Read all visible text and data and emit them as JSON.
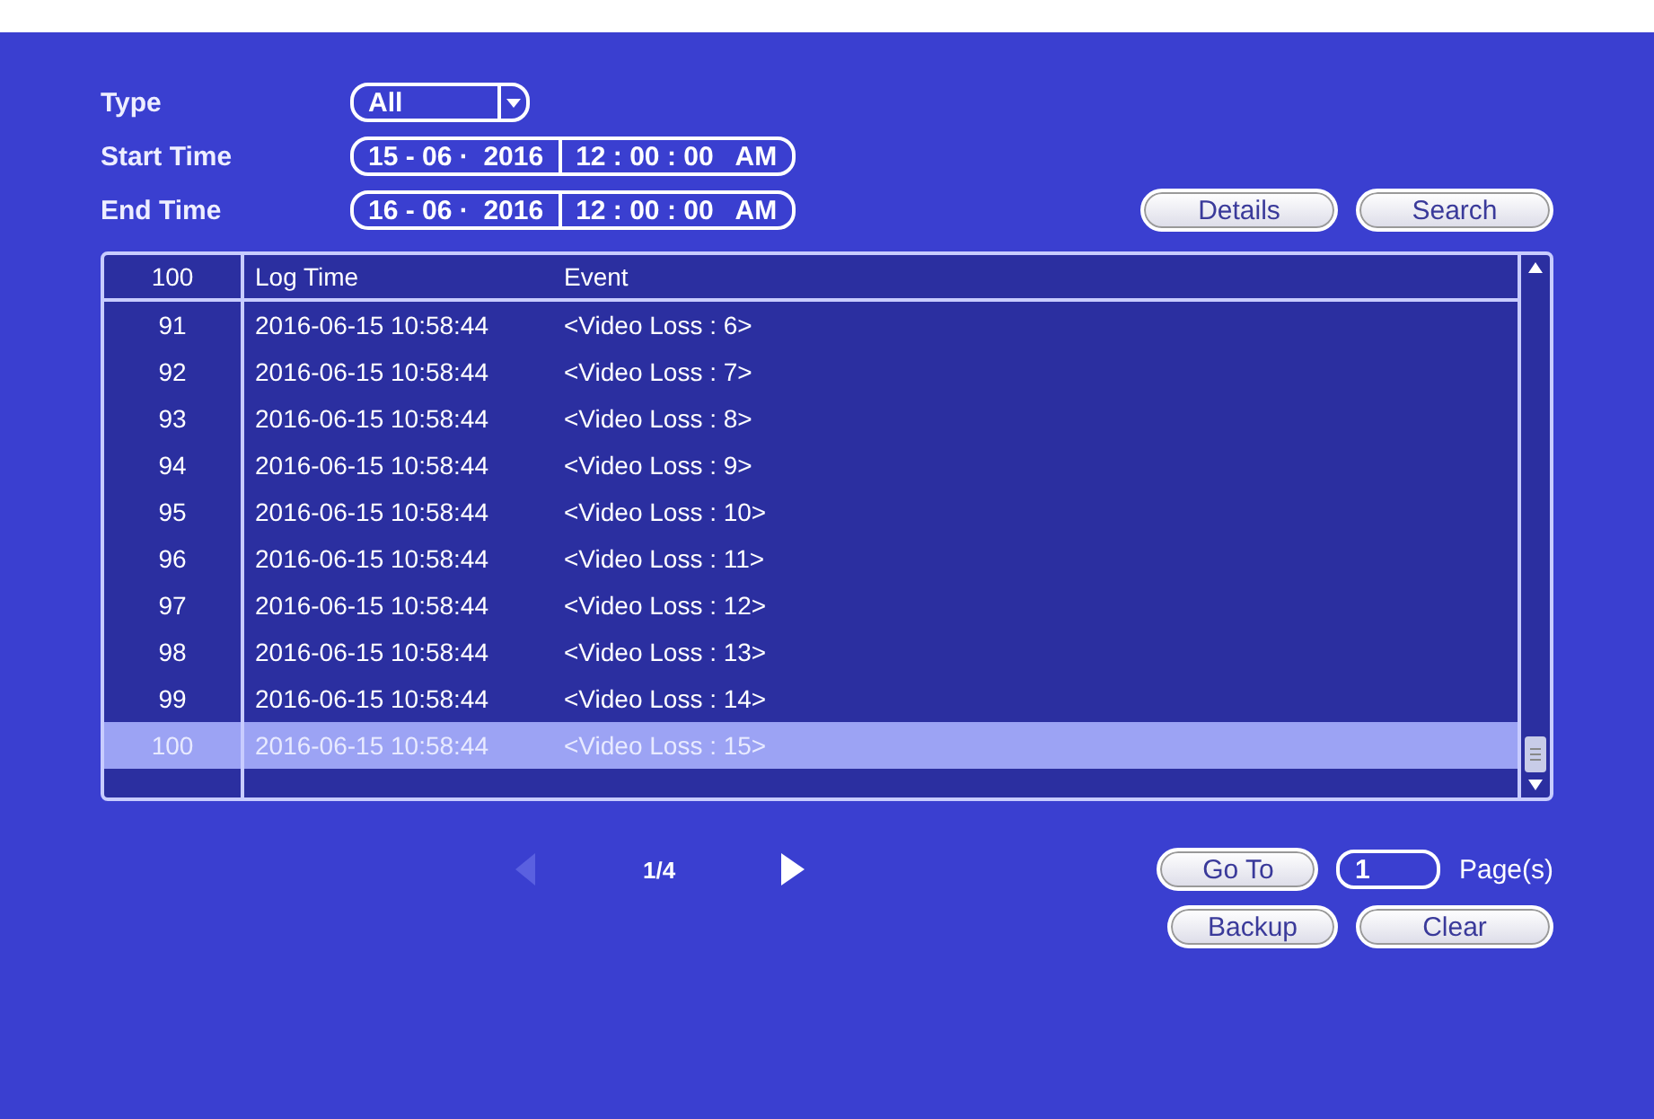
{
  "filters": {
    "type": {
      "label": "Type",
      "value": "All"
    },
    "start_time": {
      "label": "Start Time",
      "date": "15 - 06 ·  2016",
      "time": "12 : 00 : 00",
      "meridiem": "AM"
    },
    "end_time": {
      "label": "End Time",
      "date": "16 - 06 ·  2016",
      "time": "12 : 00 : 00",
      "meridiem": "AM"
    }
  },
  "search_buttons": [
    "Details",
    "Search"
  ],
  "table": {
    "columns": [
      "100",
      "Log Time",
      "Event"
    ],
    "rows": [
      {
        "no": "91",
        "time": "2016-06-15 10:58:44",
        "event": "<Video Loss : 6>",
        "selected": false
      },
      {
        "no": "92",
        "time": "2016-06-15 10:58:44",
        "event": "<Video Loss : 7>",
        "selected": false
      },
      {
        "no": "93",
        "time": "2016-06-15 10:58:44",
        "event": "<Video Loss : 8>",
        "selected": false
      },
      {
        "no": "94",
        "time": "2016-06-15 10:58:44",
        "event": "<Video Loss : 9>",
        "selected": false
      },
      {
        "no": "95",
        "time": "2016-06-15 10:58:44",
        "event": "<Video Loss : 10>",
        "selected": false
      },
      {
        "no": "96",
        "time": "2016-06-15 10:58:44",
        "event": "<Video Loss : 11>",
        "selected": false
      },
      {
        "no": "97",
        "time": "2016-06-15 10:58:44",
        "event": "<Video Loss : 12>",
        "selected": false
      },
      {
        "no": "98",
        "time": "2016-06-15 10:58:44",
        "event": "<Video Loss : 13>",
        "selected": false
      },
      {
        "no": "99",
        "time": "2016-06-15 10:58:44",
        "event": "<Video Loss : 14>",
        "selected": false
      },
      {
        "no": "100",
        "time": "2016-06-15 10:58:44",
        "event": "<Video Loss : 15>",
        "selected": true
      }
    ]
  },
  "pager": {
    "prev": {
      "disabled": true
    },
    "page": "1/4",
    "next": {
      "disabled": false
    },
    "goto": "Go To",
    "page_input": "1",
    "unit": "Page(s)"
  },
  "actions": [
    "Backup",
    "Clear"
  ]
}
